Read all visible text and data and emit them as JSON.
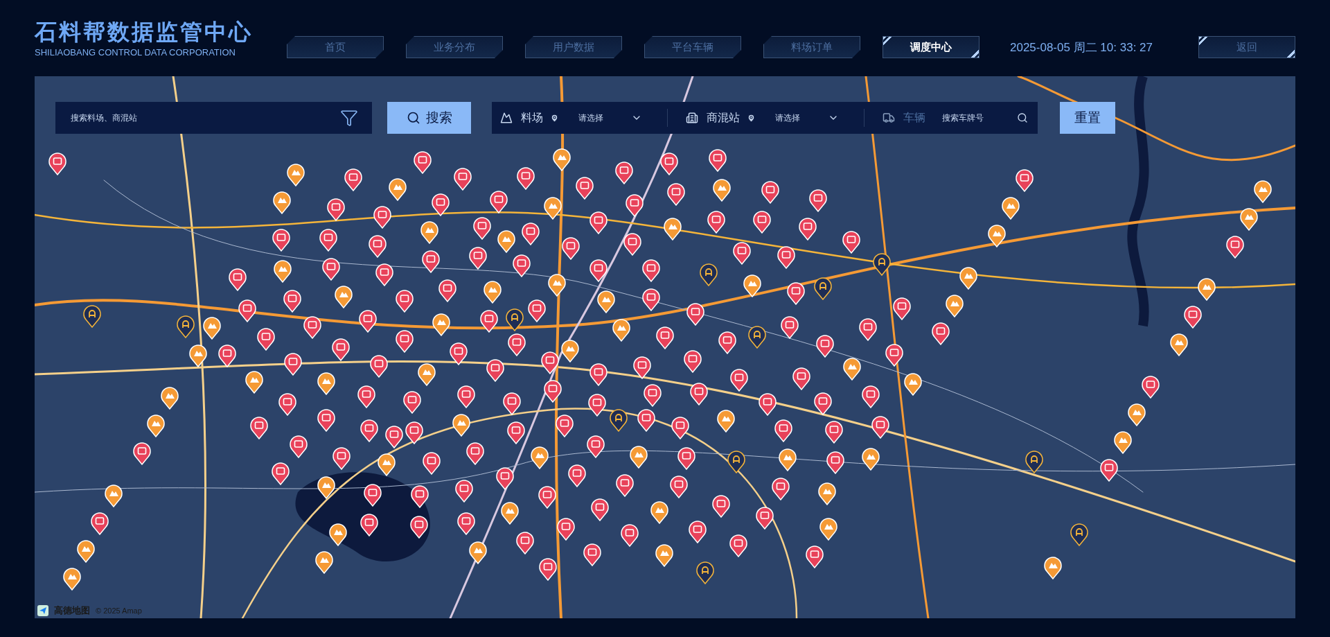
{
  "header": {
    "title": "石料帮数据监管中心",
    "subtitle": "SHILIAOBANG CONTROL DATA CORPORATION",
    "nav": [
      {
        "label": "首页",
        "selected": false
      },
      {
        "label": "业务分布",
        "selected": false
      },
      {
        "label": "用户数据",
        "selected": false
      },
      {
        "label": "平台车辆",
        "selected": false
      },
      {
        "label": "料场订单",
        "selected": false
      },
      {
        "label": "调度中心",
        "selected": true
      }
    ],
    "datetime": "2025-08-05 周二 10: 33: 27",
    "back": "返回"
  },
  "search": {
    "placeholder": "搜索料场、商混站",
    "button": "搜索"
  },
  "filters": [
    {
      "kind": "select",
      "label": "料场",
      "placeholder": "请选择"
    },
    {
      "kind": "select",
      "label": "商混站",
      "placeholder": "请选择"
    },
    {
      "kind": "text",
      "label": "车辆",
      "placeholder": "搜索车牌号"
    }
  ],
  "reset": "重置",
  "map": {
    "logo": "高德地图",
    "copyright": "© 2025 Amap"
  }
}
